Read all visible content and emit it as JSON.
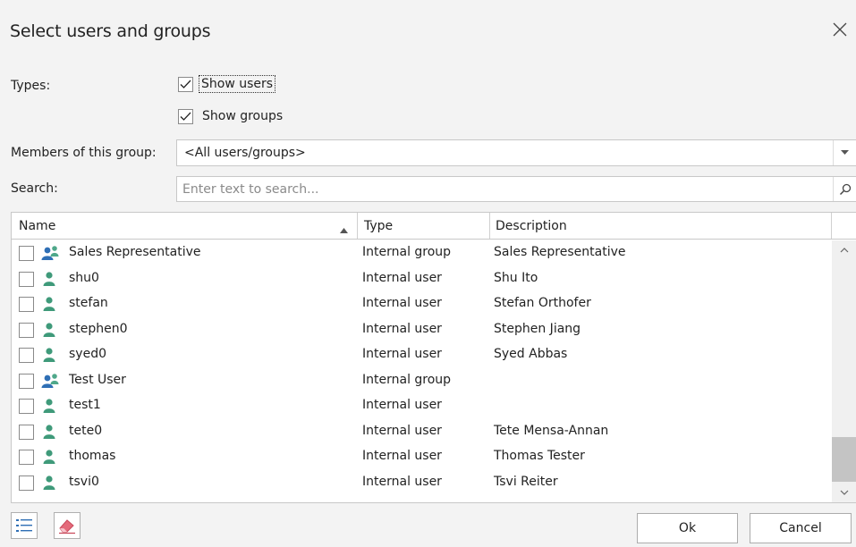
{
  "dialog": {
    "title": "Select users and groups"
  },
  "types": {
    "label": "Types:",
    "show_users": {
      "label": "Show users",
      "checked": true
    },
    "show_groups": {
      "label": "Show groups",
      "checked": true
    }
  },
  "members": {
    "label": "Members of this group:",
    "value": "<All users/groups>"
  },
  "search": {
    "label": "Search:",
    "placeholder": "Enter text to search..."
  },
  "grid": {
    "columns": {
      "name": "Name",
      "type": "Type",
      "description": "Description"
    },
    "sort": "name-ascending",
    "rows": [
      {
        "name": "Sales Representative",
        "type": "Internal group",
        "description": "Sales Representative",
        "kind": "group"
      },
      {
        "name": "shu0",
        "type": "Internal user",
        "description": "Shu Ito",
        "kind": "user"
      },
      {
        "name": "stefan",
        "type": "Internal user",
        "description": "Stefan Orthofer",
        "kind": "user"
      },
      {
        "name": "stephen0",
        "type": "Internal user",
        "description": "Stephen Jiang",
        "kind": "user"
      },
      {
        "name": "syed0",
        "type": "Internal user",
        "description": "Syed Abbas",
        "kind": "user"
      },
      {
        "name": "Test User",
        "type": "Internal group",
        "description": "",
        "kind": "group"
      },
      {
        "name": "test1",
        "type": "Internal user",
        "description": "",
        "kind": "user"
      },
      {
        "name": "tete0",
        "type": "Internal user",
        "description": "Tete Mensa-Annan",
        "kind": "user"
      },
      {
        "name": "thomas",
        "type": "Internal user",
        "description": "Thomas Tester",
        "kind": "user"
      },
      {
        "name": "tsvi0",
        "type": "Internal user",
        "description": "Tsvi Reiter",
        "kind": "user"
      }
    ]
  },
  "footer": {
    "ok_label": "Ok",
    "cancel_label": "Cancel"
  },
  "colors": {
    "user_icon": "#3f9a7a",
    "group_icon_primary": "#2f6fb5",
    "group_icon_secondary": "#4fa88a",
    "eraser": "#e46a7a"
  }
}
